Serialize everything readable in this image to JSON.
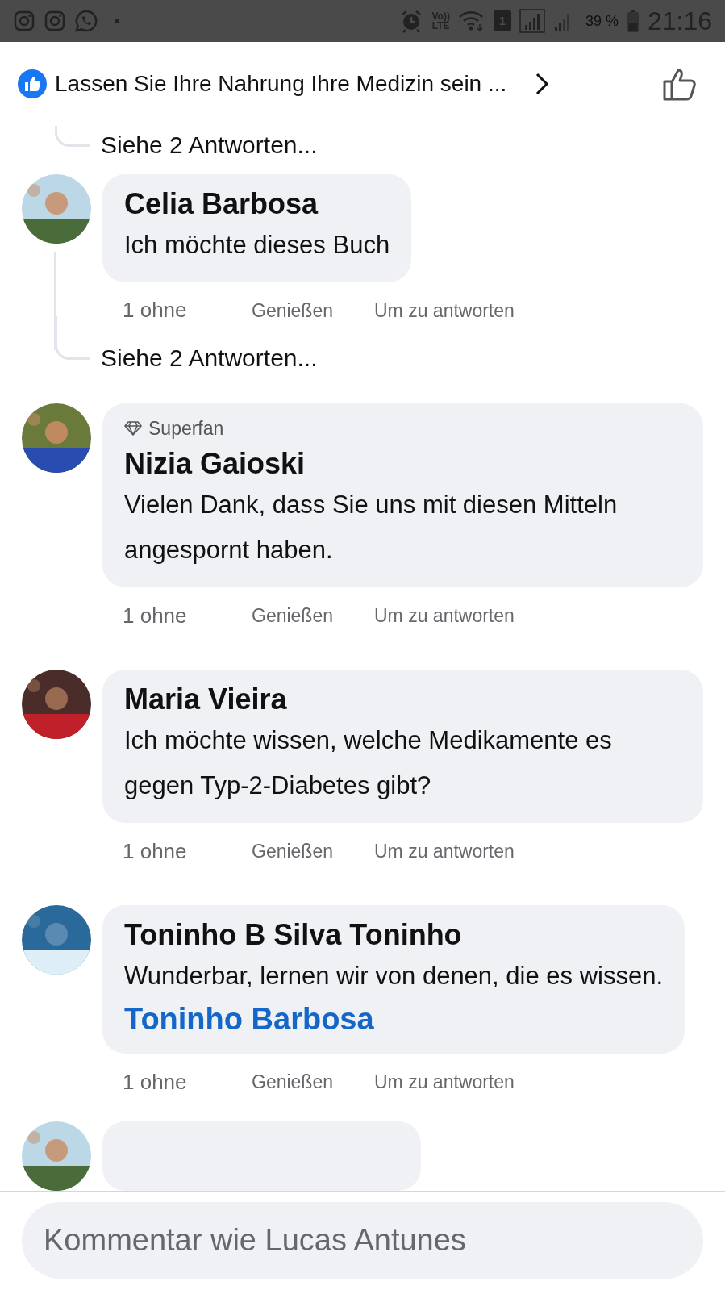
{
  "status_bar": {
    "volte": [
      "Vo))",
      "LTE"
    ],
    "sim": "1",
    "battery": "39 %",
    "time": "21:16"
  },
  "header": {
    "title": "Lassen Sie Ihre Nahrung Ihre Medizin sein ..."
  },
  "comments": [
    {
      "kind": "more_replies",
      "text": "Siehe 2 Antworten...",
      "thread_from_top": true
    },
    {
      "kind": "comment",
      "author": "Celia Barbosa",
      "text": "Ich möchte dieses Buch",
      "reactions": "1 ohne",
      "like": "Genießen",
      "reply": "Um zu antworten",
      "has_replies": true
    },
    {
      "kind": "more_replies",
      "text": "Siehe 2 Antworten...",
      "thread_from_top": false
    },
    {
      "kind": "comment",
      "badge": "Superfan",
      "author": "Nizia Gaioski",
      "text": "Vielen Dank, dass Sie uns mit diesen Mitteln angespornt haben.",
      "reactions": "1 ohne",
      "like": "Genießen",
      "reply": "Um zu antworten",
      "has_replies": false
    },
    {
      "kind": "comment",
      "author": "Maria Vieira",
      "text": "Ich möchte wissen, welche Medikamente es gegen Typ-2-Diabetes gibt?",
      "reactions": "1 ohne",
      "like": "Genießen",
      "reply": "Um zu antworten",
      "has_replies": false
    },
    {
      "kind": "comment",
      "author": "Toninho B Silva Toninho",
      "text": "Wunderbar, lernen wir von denen, die es wissen.",
      "mention": "Toninho Barbosa",
      "reactions": "1 ohne",
      "like": "Genießen",
      "reply": "Um zu antworten",
      "has_replies": false
    },
    {
      "kind": "cut_comment"
    }
  ],
  "composer": {
    "placeholder": "Kommentar wie Lucas Antunes"
  }
}
